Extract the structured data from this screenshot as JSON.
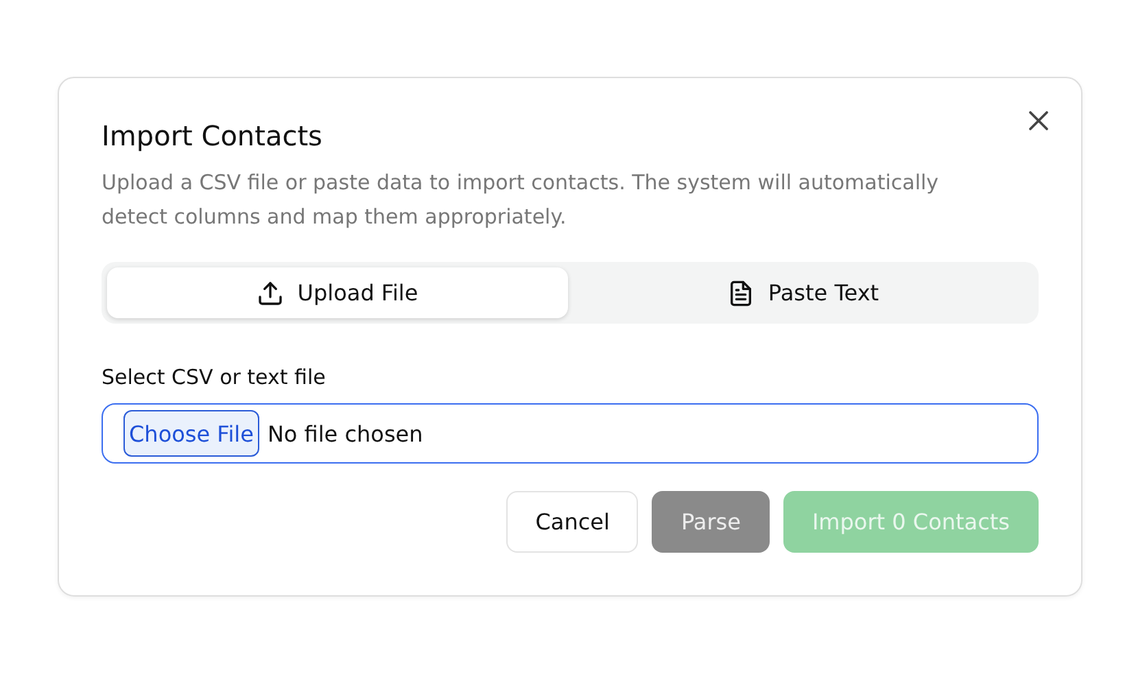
{
  "dialog": {
    "title": "Import Contacts",
    "description": "Upload a CSV file or paste data to import contacts. The system will automatically detect columns and map them appropriately.",
    "tabs": [
      {
        "label": "Upload File",
        "kind": "upload",
        "selected": true
      },
      {
        "label": "Paste Text",
        "kind": "document",
        "selected": false
      }
    ],
    "file_field": {
      "label": "Select CSV or text file",
      "button": "Choose File",
      "value": "No file chosen",
      "focused": true
    },
    "buttons": [
      {
        "label": "Cancel",
        "kind": "outline",
        "disabled": false
      },
      {
        "label": "Parse",
        "kind": "secondary",
        "disabled": true
      },
      {
        "label": "Import 0 Contacts",
        "kind": "primary",
        "disabled": true
      }
    ]
  }
}
